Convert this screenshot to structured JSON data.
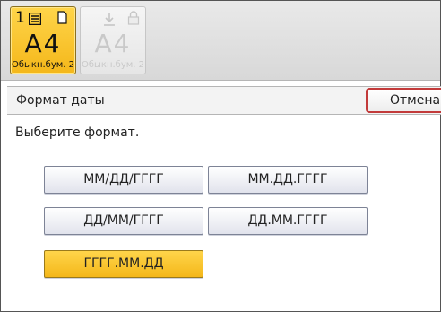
{
  "trays": [
    {
      "number": "1",
      "paper_size": "A4",
      "paper_type": "Обыкн.бум. 2",
      "state": "selected",
      "icons": [
        "list-icon",
        "document-icon"
      ]
    },
    {
      "number": "",
      "paper_size": "A4",
      "paper_type": "Обыкн.бум. 2",
      "state": "disabled",
      "icons": [
        "download-icon",
        "lock-icon"
      ]
    }
  ],
  "dialog": {
    "title": "Формат даты",
    "cancel_label": "Отмена",
    "prompt": "Выберите формат."
  },
  "formats": [
    {
      "label": "ММ/ДД/ГГГГ",
      "selected": false
    },
    {
      "label": "ММ.ДД.ГГГГ",
      "selected": false
    },
    {
      "label": "ДД/ММ/ГГГГ",
      "selected": false
    },
    {
      "label": "ДД.ММ.ГГГГ",
      "selected": false
    },
    {
      "label": "ГГГГ.ММ.ДД",
      "selected": true
    }
  ],
  "colors": {
    "accent_selected": "#f4b71a",
    "cancel_border": "#c23a3a"
  }
}
